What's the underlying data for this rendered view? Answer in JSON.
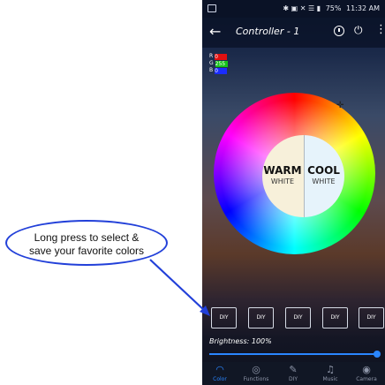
{
  "status_bar": {
    "icons": "✱ ▣ ✕ ☰ ▮",
    "battery": "75%",
    "time": "11:32 AM"
  },
  "app_bar": {
    "title": "Controller - 1"
  },
  "rgb_readout": {
    "r_label": "R",
    "r_value": "0",
    "g_label": "G",
    "g_value": "255",
    "b_label": "B",
    "b_value": "0"
  },
  "color_wheel": {
    "warm_big": "WARM",
    "warm_small": "WHITE",
    "cool_big": "COOL",
    "cool_small": "WHITE"
  },
  "diy_buttons": [
    "DIY",
    "DIY",
    "DIY",
    "DIY",
    "DIY"
  ],
  "brightness": {
    "label": "Brightness: 100%",
    "value": 100
  },
  "bottom_nav": [
    "Color",
    "Functions",
    "DIY",
    "Music",
    "Camera"
  ],
  "callout": {
    "line1": "Long press to select &",
    "line2": "save your favorite colors"
  },
  "colors": {
    "callout_blue": "#2240d9",
    "accent": "#2a86ff"
  }
}
